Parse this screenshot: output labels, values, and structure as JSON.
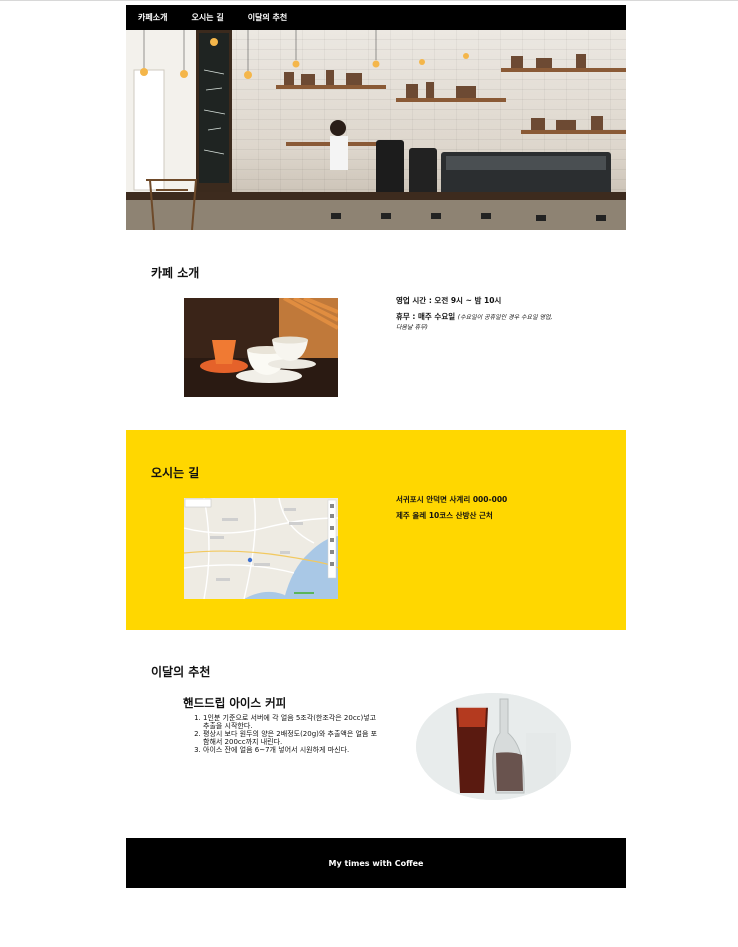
{
  "nav": {
    "items": [
      {
        "label": "카페소개"
      },
      {
        "label": "오시는 길"
      },
      {
        "label": "이달의 추천"
      }
    ]
  },
  "intro": {
    "title": "카페 소개",
    "hours": "영업 시간 : 오전 9시 ~ 밤 10시",
    "closed": "휴무 : 매주 수요일",
    "closed_note_1": "(수요일이 공휴일인 경우 수요일 영업,",
    "closed_note_2": "다음날 휴무)"
  },
  "direction": {
    "title": "오시는 길",
    "address": "서귀포시 안덕면 사계리 000-000",
    "landmark": "제주 올레 10코스 산방산 근처"
  },
  "recommend": {
    "title": "이달의 추천",
    "menu_title": "핸드드립 아이스 커피",
    "steps": [
      "1인분 기준으로 서버에 각 얼음 5조각(한조각은 20cc)넣고 추출을 시작한다.",
      "평상시 보다 원두의 양은 2배정도(20g)와 추출액은 얼음 포함해서 200cc까지 내린다.",
      "아이스 잔에 얼음 6~7개 넣어서 시원하게 마신다."
    ]
  },
  "footer": {
    "text": "My times with Coffee"
  }
}
